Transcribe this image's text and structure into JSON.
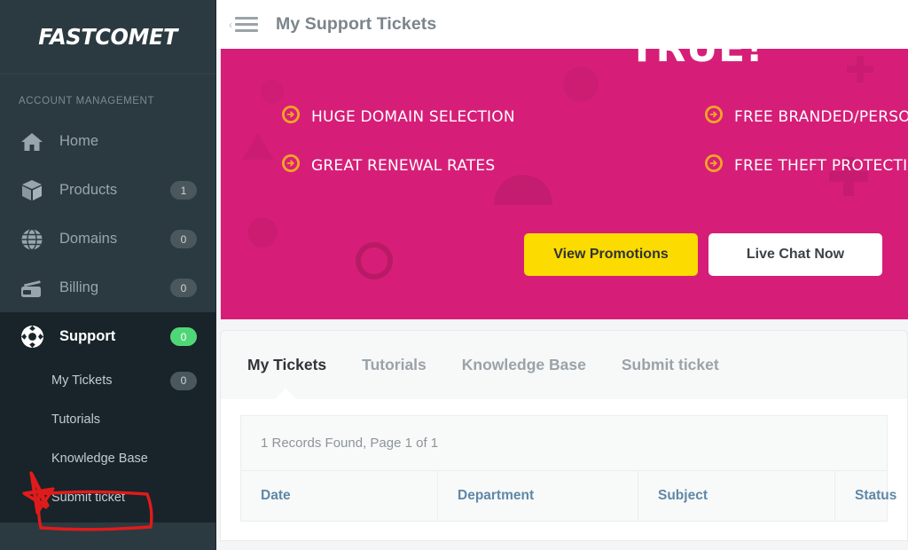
{
  "sidebar": {
    "logo": "FASTCOMET",
    "section_label": "ACCOUNT MANAGEMENT",
    "items": [
      {
        "label": "Home",
        "badge": "",
        "icon": "home-icon",
        "active": false
      },
      {
        "label": "Products",
        "badge": "1",
        "icon": "box-icon",
        "active": false
      },
      {
        "label": "Domains",
        "badge": "0",
        "icon": "globe-icon",
        "active": false
      },
      {
        "label": "Billing",
        "badge": "0",
        "icon": "credit-card-icon",
        "active": false
      },
      {
        "label": "Support",
        "badge": "0",
        "icon": "lifering-icon",
        "active": true
      }
    ],
    "sub_items": [
      {
        "label": "My Tickets",
        "badge": "0"
      },
      {
        "label": "Tutorials",
        "badge": ""
      },
      {
        "label": "Knowledge Base",
        "badge": ""
      },
      {
        "label": "Submit ticket",
        "badge": ""
      }
    ]
  },
  "header": {
    "title": "My Support Tickets",
    "menu_icon": "hamburger-icon",
    "collapse_icon": "chevron-left-icon"
  },
  "banner": {
    "heading": "TRUE!",
    "features_left": [
      "HUGE DOMAIN SELECTION",
      "GREAT RENEWAL RATES"
    ],
    "features_right": [
      "FREE BRANDED/PERSONAL",
      "FREE THEFT PROTECTION"
    ],
    "primary_button": "View Promotions",
    "secondary_button": "Live Chat Now",
    "background_color": "#d61e78",
    "primary_button_color": "#fbdb00"
  },
  "tabs": [
    {
      "label": "My Tickets",
      "active": true
    },
    {
      "label": "Tutorials",
      "active": false
    },
    {
      "label": "Knowledge Base",
      "active": false
    },
    {
      "label": "Submit ticket",
      "active": false
    }
  ],
  "tickets_panel": {
    "records_text": "1 Records Found, Page 1 of 1",
    "columns": [
      "Date",
      "Department",
      "Subject",
      "Status"
    ]
  },
  "annotation": {
    "shapes": [
      "red-star",
      "red-rectangle"
    ],
    "color": "#e01b1b",
    "target": "Submit ticket"
  }
}
